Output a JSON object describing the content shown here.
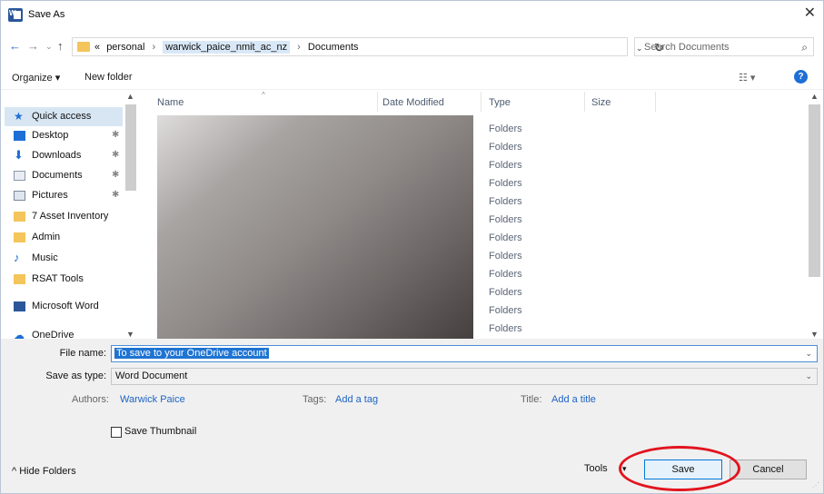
{
  "window": {
    "title": "Save As",
    "close_glyph": "✕"
  },
  "nav": {
    "back_icon": "←",
    "forward_icon": "→",
    "recent_icon": "⌄",
    "up_icon": "↑",
    "breadcrumb_prefix": "«",
    "breadcrumbs": [
      "personal",
      "warwick_paice_nmit_ac_nz",
      "Documents"
    ],
    "breadcrumb_sep": "›",
    "refresh_icon": "↻",
    "search_placeholder": "Search Documents",
    "search_icon": "⌕"
  },
  "toolbar": {
    "organize": "Organize ▾",
    "new_folder": "New folder",
    "view_icon": "☷ ▾",
    "help": "?"
  },
  "sidebar": {
    "items": [
      {
        "label": "Quick access",
        "icon": "star-icon",
        "pinned": false,
        "selected": true
      },
      {
        "label": "Desktop",
        "icon": "desktop-icon",
        "pinned": true
      },
      {
        "label": "Downloads",
        "icon": "download-icon",
        "pinned": true
      },
      {
        "label": "Documents",
        "icon": "document-icon",
        "pinned": true
      },
      {
        "label": "Pictures",
        "icon": "pictures-icon",
        "pinned": true
      },
      {
        "label": "7 Asset Inventory",
        "icon": "folder-icon",
        "pinned": false
      },
      {
        "label": "Admin",
        "icon": "folder-icon",
        "pinned": false
      },
      {
        "label": "Music",
        "icon": "music-icon",
        "pinned": false
      },
      {
        "label": "RSAT Tools",
        "icon": "folder-icon",
        "pinned": false
      },
      {
        "label": "Microsoft Word",
        "icon": "word-icon",
        "pinned": false
      },
      {
        "label": "OneDrive",
        "icon": "cloud-icon",
        "pinned": false
      }
    ],
    "pin_glyph": "✱"
  },
  "list": {
    "columns": [
      "Name",
      "Date Modified",
      "Type",
      "Size"
    ],
    "types": [
      "Folders",
      "Folders",
      "Folders",
      "Folders",
      "Folders",
      "Folders",
      "Folders",
      "Folders",
      "Folders",
      "Folders",
      "Folders",
      "Folders"
    ]
  },
  "form": {
    "file_name_label": "File name:",
    "file_name_value": "To save to your OneDrive account",
    "save_type_label": "Save as type:",
    "save_type_value": "Word Document",
    "authors_label": "Authors:",
    "authors_value": "Warwick Paice",
    "tags_label": "Tags:",
    "tags_value": "Add a tag",
    "title_label": "Title:",
    "title_value": "Add a title",
    "thumbnail_label": "Save Thumbnail",
    "dropdown_glyph": "⌄"
  },
  "footer": {
    "hide_folders": "^  Hide Folders",
    "tools": "Tools",
    "tools_chevron": "▾",
    "save": "Save",
    "cancel": "Cancel"
  },
  "colors": {
    "accent": "#1e74d2",
    "highlight_oval": "#e2141e"
  }
}
